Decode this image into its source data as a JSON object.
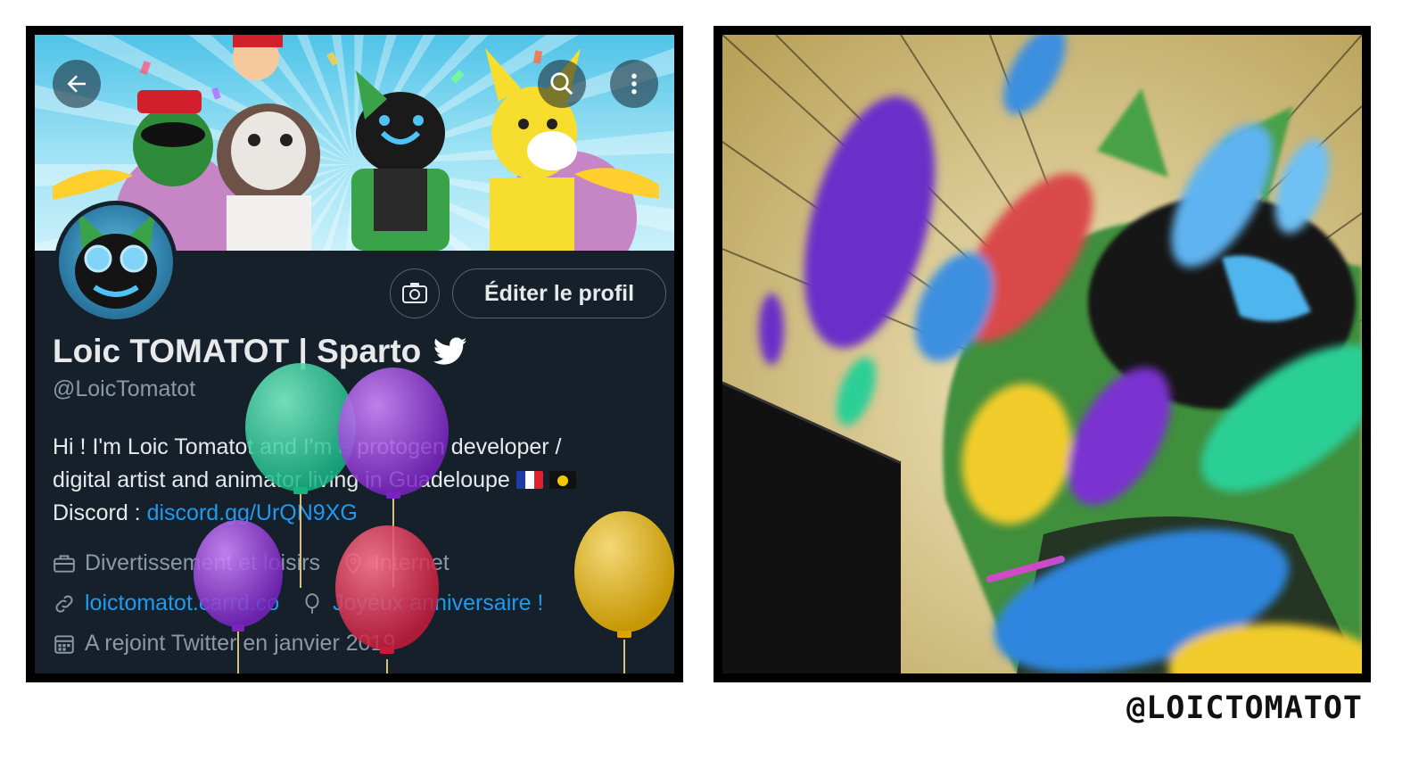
{
  "profile": {
    "display_name": "Loic TOMATOT | Sparto",
    "handle": "@LoicTomatot",
    "bio_line1": "Hi ! I'm Loic Tomatot and I'm a protogen developer /",
    "bio_line2": "digital artist and animator living in Guadeloupe",
    "discord_label": "Discord : ",
    "discord_link": "discord.gg/UrQN9XG",
    "category": "Divertissement et loisirs",
    "location": "Internet",
    "website": "loictomatot.carrd.co",
    "birthday": "Joyeux anniversaire !",
    "joined": "A rejoint Twitter en janvier 2019",
    "edit_button": "Éditer le profil"
  },
  "icons": {
    "back": "arrow-left-icon",
    "search": "search-icon",
    "more": "more-vertical-icon",
    "verified": "twitter-bird-icon",
    "camera": "camera-icon",
    "category": "briefcase-icon",
    "location": "location-pin-icon",
    "website": "link-icon",
    "birthday": "balloon-icon",
    "joined": "calendar-icon"
  },
  "colors": {
    "background": "#15202b",
    "text": "#e7e9ea",
    "secondary": "#8b98a5",
    "link": "#1d9bf0",
    "balloon_green": "#2fd3a0",
    "balloon_purple": "#9b3fd6",
    "balloon_red": "#e0304e",
    "balloon_yellow": "#f2c21a"
  },
  "credit": "@LOICTOMATOT"
}
